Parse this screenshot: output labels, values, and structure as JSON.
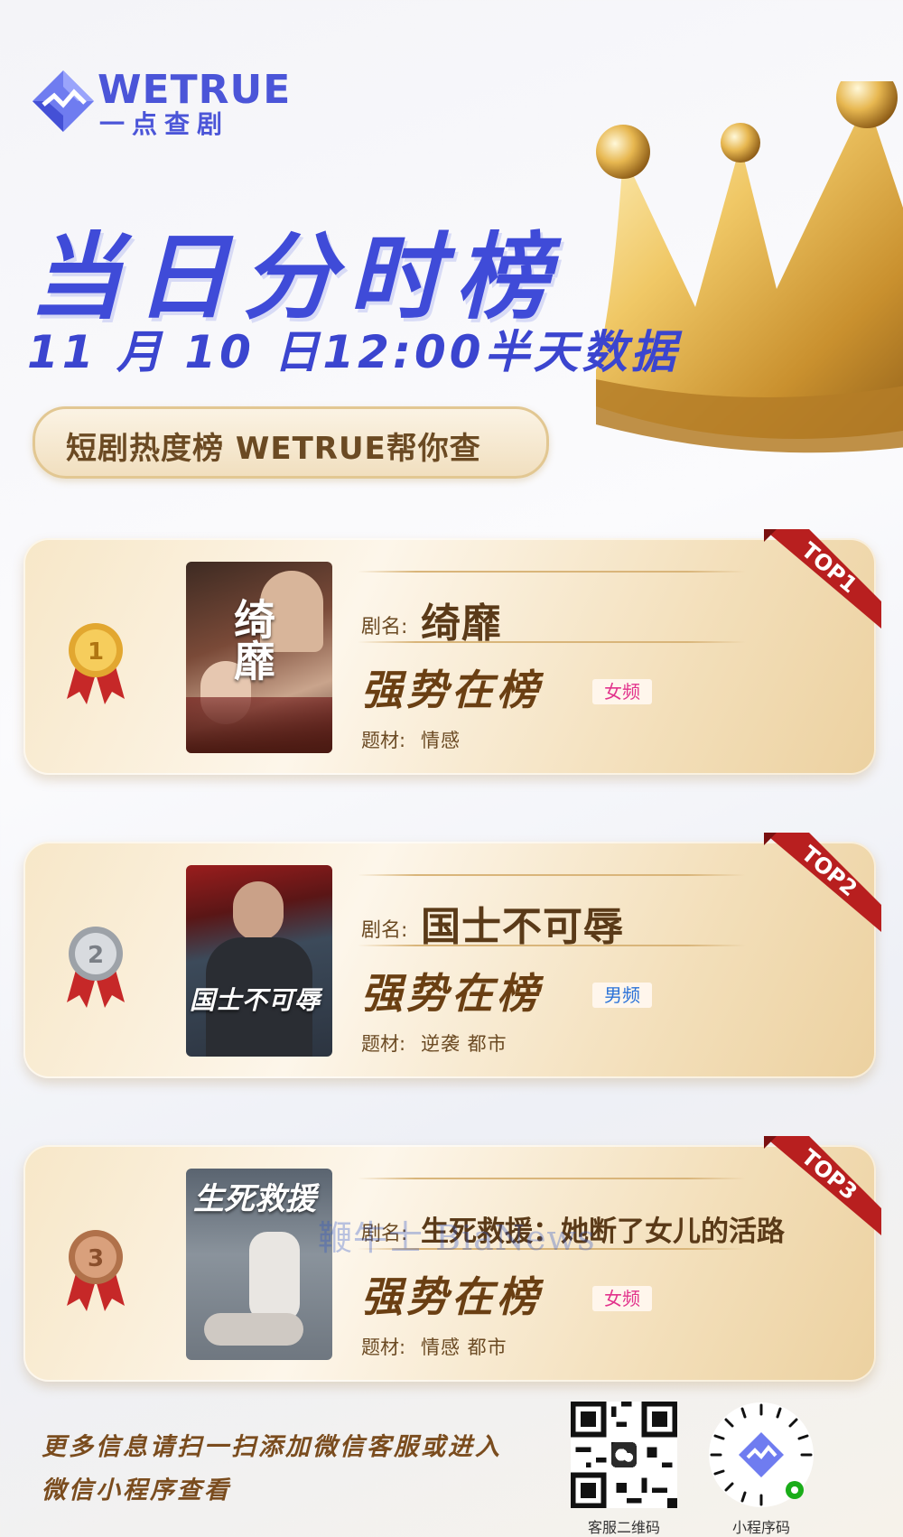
{
  "brand": {
    "name_en": "WETRUE",
    "name_cn": "一点查剧"
  },
  "header": {
    "title": "当日分时榜",
    "subtitle": "11 月 10 日12:00半天数据",
    "pill": "短剧热度榜 WETRUE帮你查"
  },
  "cards": [
    {
      "top": "TOP1",
      "name_label": "剧名:",
      "name": "绮靡",
      "poster_title": "绮靡",
      "status": "强势在榜",
      "tag": "女频",
      "genre_label": "题材:",
      "genre": "情感",
      "medal_number": "1"
    },
    {
      "top": "TOP2",
      "name_label": "剧名:",
      "name": "国士不可辱",
      "poster_title": "国士不可辱",
      "status": "强势在榜",
      "tag": "男频",
      "genre_label": "题材:",
      "genre": "逆袭 都市",
      "medal_number": "2"
    },
    {
      "top": "TOP3",
      "name_label": "剧名:",
      "name": "生死救援：她断了女儿的活路",
      "poster_title": "生死救援",
      "status": "强势在榜",
      "tag": "女频",
      "genre_label": "题材:",
      "genre": "情感 都市",
      "medal_number": "3"
    }
  ],
  "watermark": "鞭牛士 BiaNews",
  "footer": {
    "line1": "更多信息请扫一扫添加微信客服或进入",
    "line2": "微信小程序查看",
    "qr1_label": "客服二维码",
    "qr2_label": "小程序码"
  }
}
